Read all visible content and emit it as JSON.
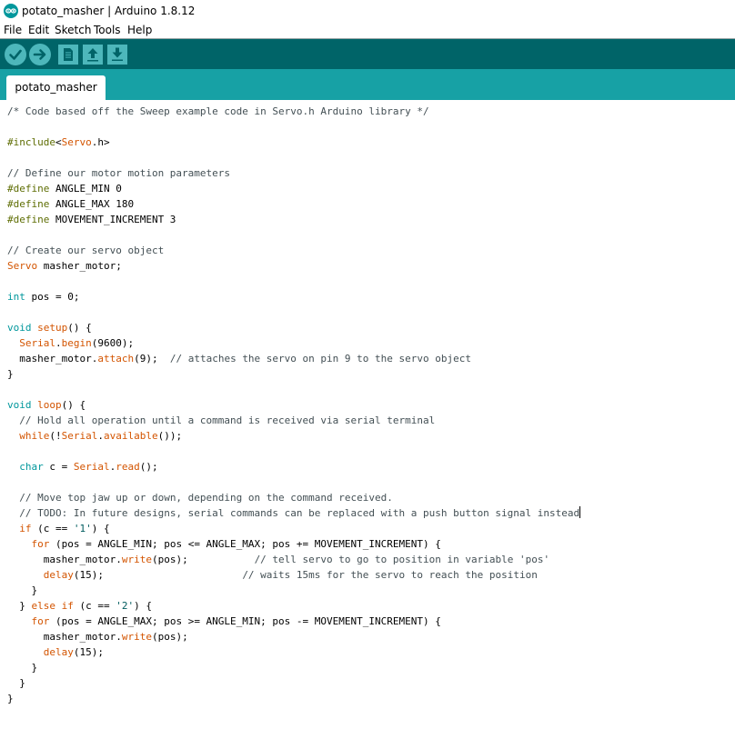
{
  "window": {
    "title": "potato_masher | Arduino 1.8.12"
  },
  "menu": [
    "File",
    "Edit",
    "Sketch",
    "Tools",
    "Help"
  ],
  "toolbar": {
    "buttons": [
      {
        "name": "verify-button",
        "icon": "checkmark-icon"
      },
      {
        "name": "upload-button",
        "icon": "right-arrow-icon"
      },
      {
        "name": "new-button",
        "icon": "document-icon"
      },
      {
        "name": "open-button",
        "icon": "up-arrow-icon"
      },
      {
        "name": "save-button",
        "icon": "down-arrow-icon"
      }
    ]
  },
  "tabs": [
    {
      "label": "potato_masher",
      "active": true
    }
  ],
  "colors": {
    "toolbar_bg": "#006468",
    "tabbar_bg": "#17a1a5",
    "keyword": "#d35400",
    "type": "#00979c",
    "preprocessor": "#5e6d03",
    "comment": "#434f54"
  },
  "editor": {
    "lines": [
      [
        [
          "c",
          "/* Code based off the Sweep example code in Servo.h Arduino library */"
        ]
      ],
      [],
      [
        [
          "p",
          "#include"
        ],
        [
          "",
          "<"
        ],
        [
          "k",
          "Servo"
        ],
        [
          "",
          ".h>"
        ]
      ],
      [],
      [
        [
          "c",
          "// Define our motor motion parameters"
        ]
      ],
      [
        [
          "p",
          "#define"
        ],
        [
          "",
          " ANGLE_MIN 0"
        ]
      ],
      [
        [
          "p",
          "#define"
        ],
        [
          "",
          " ANGLE_MAX 180"
        ]
      ],
      [
        [
          "p",
          "#define"
        ],
        [
          "",
          " MOVEMENT_INCREMENT 3"
        ]
      ],
      [],
      [
        [
          "c",
          "// Create our servo object"
        ]
      ],
      [
        [
          "k",
          "Servo"
        ],
        [
          "",
          " masher_motor;"
        ]
      ],
      [],
      [
        [
          "t",
          "int"
        ],
        [
          "",
          " pos = 0;"
        ]
      ],
      [],
      [
        [
          "t",
          "void"
        ],
        [
          "",
          " "
        ],
        [
          "k",
          "setup"
        ],
        [
          "",
          "() {"
        ]
      ],
      [
        [
          "",
          "  "
        ],
        [
          "k",
          "Serial"
        ],
        [
          "",
          "."
        ],
        [
          "k",
          "begin"
        ],
        [
          "",
          "(9600);"
        ]
      ],
      [
        [
          "",
          "  masher_motor."
        ],
        [
          "k",
          "attach"
        ],
        [
          "",
          "(9);  "
        ],
        [
          "c",
          "// attaches the servo on pin 9 to the servo object"
        ]
      ],
      [
        [
          "",
          "}"
        ]
      ],
      [],
      [
        [
          "t",
          "void"
        ],
        [
          "",
          " "
        ],
        [
          "k",
          "loop"
        ],
        [
          "",
          "() {"
        ]
      ],
      [
        [
          "",
          "  "
        ],
        [
          "c",
          "// Hold all operation until a command is received via serial terminal"
        ]
      ],
      [
        [
          "",
          "  "
        ],
        [
          "k",
          "while"
        ],
        [
          "",
          "(!"
        ],
        [
          "k",
          "Serial"
        ],
        [
          "",
          "."
        ],
        [
          "k",
          "available"
        ],
        [
          "",
          "());"
        ]
      ],
      [],
      [
        [
          "",
          "  "
        ],
        [
          "t",
          "char"
        ],
        [
          "",
          " c = "
        ],
        [
          "k",
          "Serial"
        ],
        [
          "",
          "."
        ],
        [
          "k",
          "read"
        ],
        [
          "",
          "();"
        ]
      ],
      [],
      [
        [
          "",
          "  "
        ],
        [
          "c",
          "// Move top jaw up or down, depending on the command received."
        ]
      ],
      [
        [
          "",
          "  "
        ],
        [
          "c",
          "// TODO: In future designs, serial commands can be replaced with a push button signal instead"
        ]
      ],
      [
        [
          "",
          "  "
        ],
        [
          "k",
          "if"
        ],
        [
          "",
          " (c == "
        ],
        [
          "s",
          "'1'"
        ],
        [
          "",
          ") {"
        ]
      ],
      [
        [
          "",
          "    "
        ],
        [
          "k",
          "for"
        ],
        [
          "",
          " (pos = ANGLE_MIN; pos <= ANGLE_MAX; pos += MOVEMENT_INCREMENT) {"
        ]
      ],
      [
        [
          "",
          "      masher_motor."
        ],
        [
          "k",
          "write"
        ],
        [
          "",
          "(pos);           "
        ],
        [
          "c",
          "// tell servo to go to position in variable 'pos'"
        ]
      ],
      [
        [
          "",
          "      "
        ],
        [
          "k",
          "delay"
        ],
        [
          "",
          "(15);                       "
        ],
        [
          "c",
          "// waits 15ms for the servo to reach the position"
        ]
      ],
      [
        [
          "",
          "    }"
        ]
      ],
      [
        [
          "",
          "  } "
        ],
        [
          "k",
          "else"
        ],
        [
          "",
          " "
        ],
        [
          "k",
          "if"
        ],
        [
          "",
          " (c == "
        ],
        [
          "s",
          "'2'"
        ],
        [
          "",
          ") {"
        ]
      ],
      [
        [
          "",
          "    "
        ],
        [
          "k",
          "for"
        ],
        [
          "",
          " (pos = ANGLE_MAX; pos >= ANGLE_MIN; pos -= MOVEMENT_INCREMENT) {"
        ]
      ],
      [
        [
          "",
          "      masher_motor."
        ],
        [
          "k",
          "write"
        ],
        [
          "",
          "(pos);"
        ]
      ],
      [
        [
          "",
          "      "
        ],
        [
          "k",
          "delay"
        ],
        [
          "",
          "(15);"
        ]
      ],
      [
        [
          "",
          "    }"
        ]
      ],
      [
        [
          "",
          "  }"
        ]
      ],
      [
        [
          "",
          "}"
        ]
      ]
    ],
    "caret_line": 26
  }
}
